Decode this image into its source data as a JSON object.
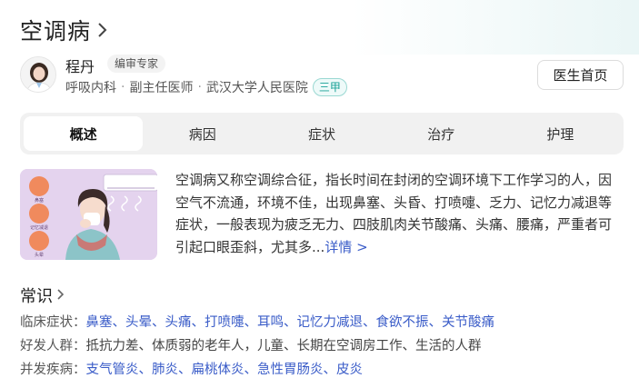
{
  "header": {
    "title": "空调病",
    "chevron_icon": "chevron-right-icon"
  },
  "doctor": {
    "name": "程丹",
    "editor_badge": "编审专家",
    "department": "呼吸内科",
    "position": "副主任医师",
    "hospital": "武汉大学人民医院",
    "grade_badge": "三甲",
    "home_button": "医生首页",
    "separator": "·"
  },
  "tabs": [
    {
      "label": "概述",
      "active": true
    },
    {
      "label": "病因",
      "active": false
    },
    {
      "label": "症状",
      "active": false
    },
    {
      "label": "治疗",
      "active": false
    },
    {
      "label": "护理",
      "active": false
    }
  ],
  "summary": {
    "text": "空调病又称空调综合征，指长时间在封闭的空调环境下工作学习的人，因空气不流通，环境不佳，出现鼻塞、头昏、打喷嚏、乏力、记忆力减退等症状，一般表现为疲乏无力、四肢肌肉关节酸痛、头痛、腰痛，严重者可引起口眼歪斜，尤其多...",
    "more_link": "详情 >"
  },
  "illustration": {
    "labels": [
      "鼻塞",
      "记忆减退",
      "头晕"
    ]
  },
  "knowledge": {
    "title": "常识",
    "clinical_label": "临床症状：",
    "clinical_items": [
      "鼻塞",
      "头晕",
      "头痛",
      "打喷嚏",
      "耳鸣",
      "记忆力减退",
      "食欲不振",
      "关节酸痛"
    ],
    "population_label": "好发人群：",
    "population_text": "抵抗力差、体质弱的老年人，儿童、长期在空调房工作、生活的人群",
    "complication_label": "并发疾病：",
    "complication_items": [
      "支气管炎",
      "肺炎",
      "扁桃体炎",
      "急性胃肠炎",
      "皮炎"
    ],
    "list_separator": "、"
  },
  "colors": {
    "link": "#3a5cc8",
    "grade_badge": "#19a196",
    "tab_bg": "#f1f1f1",
    "illustration_bg": "#e4d3ee"
  }
}
